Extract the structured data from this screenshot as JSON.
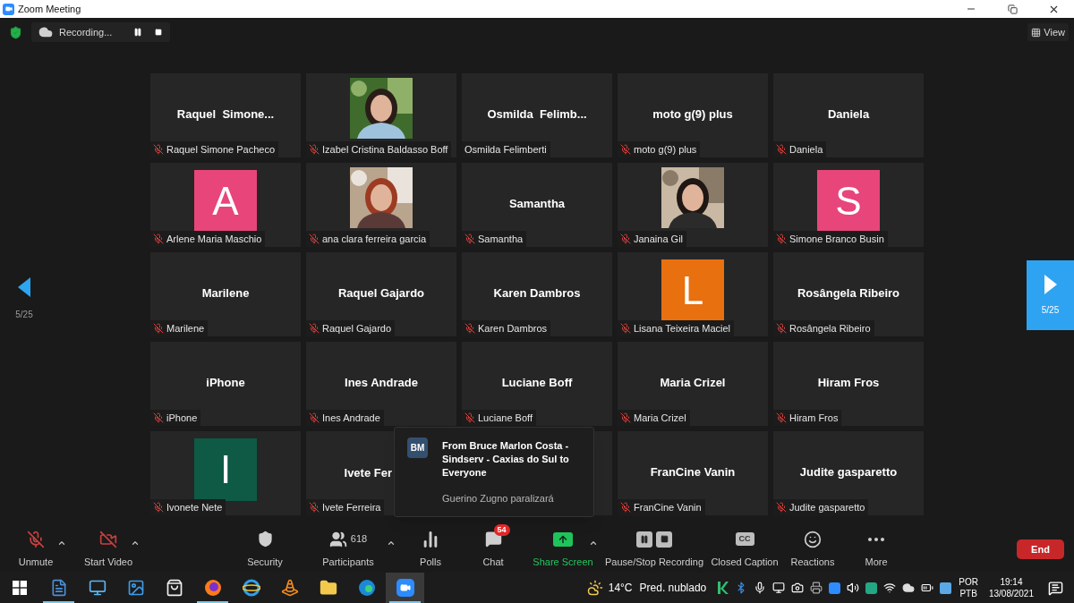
{
  "window": {
    "title": "Zoom Meeting"
  },
  "recording": {
    "label": "Recording..."
  },
  "view_button": {
    "label": "View"
  },
  "pager_left": {
    "label": "5/25"
  },
  "pager_right": {
    "label": "5/25"
  },
  "tiles": [
    {
      "kind": "name",
      "title": "Raquel  Simone...",
      "name": "Raquel Simone Pacheco",
      "muted": true
    },
    {
      "kind": "video",
      "name": "Izabel Cristina Baldasso Boff",
      "muted": true
    },
    {
      "kind": "name",
      "title": "Osmilda  Felimb...",
      "name": "Osmilda Felimberti",
      "muted": false
    },
    {
      "kind": "name",
      "title": "moto g(9) plus",
      "name": "moto g(9) plus",
      "muted": true
    },
    {
      "kind": "name",
      "title": "Daniela",
      "name": "Daniela",
      "muted": true
    },
    {
      "kind": "avatar",
      "letter": "A",
      "color": "#e8457b",
      "name": "Arlene Maria Maschio",
      "muted": true
    },
    {
      "kind": "video",
      "name": "ana clara ferreira garcia",
      "muted": true
    },
    {
      "kind": "name",
      "title": "Samantha",
      "name": "Samantha",
      "muted": true
    },
    {
      "kind": "video",
      "name": "Janaina Gil",
      "muted": true
    },
    {
      "kind": "avatar",
      "letter": "S",
      "color": "#e8457b",
      "name": "Simone Branco Busin",
      "muted": true
    },
    {
      "kind": "name",
      "title": "Marilene",
      "name": "Marilene",
      "muted": true
    },
    {
      "kind": "name",
      "title": "Raquel Gajardo",
      "name": "Raquel Gajardo",
      "muted": true
    },
    {
      "kind": "name",
      "title": "Karen Dambros",
      "name": "Karen Dambros",
      "muted": true
    },
    {
      "kind": "avatar",
      "letter": "L",
      "color": "#e8700f",
      "name": "Lisana Teixeira Maciel",
      "muted": true
    },
    {
      "kind": "name",
      "title": "Rosângela Ribeiro",
      "name": "Rosângela Ribeiro",
      "muted": true
    },
    {
      "kind": "name",
      "title": "iPhone",
      "name": "iPhone",
      "muted": true
    },
    {
      "kind": "name",
      "title": "Ines Andrade",
      "name": "Ines Andrade",
      "muted": true
    },
    {
      "kind": "name",
      "title": "Luciane Boff",
      "name": "Luciane Boff",
      "muted": true
    },
    {
      "kind": "name",
      "title": "Maria Crizel",
      "name": "Maria Crizel",
      "muted": true
    },
    {
      "kind": "name",
      "title": "Hiram Fros",
      "name": "Hiram Fros",
      "muted": true
    },
    {
      "kind": "avatar",
      "letter": "I",
      "color": "#0e5a45",
      "name": "Ivonete Nete",
      "muted": true
    },
    {
      "kind": "name_partial",
      "title": "Ivete Fer",
      "name": "Ivete Ferreira",
      "muted": true
    },
    {
      "kind": "covered"
    },
    {
      "kind": "name",
      "title": "FranCine Vanin",
      "name": "FranCine Vanin",
      "muted": true
    },
    {
      "kind": "name",
      "title": "Judite gasparetto",
      "name": "Judite gasparetto",
      "muted": true
    }
  ],
  "chat_popup": {
    "initials": "BM",
    "title": "From Bruce Marlon Costa - Sindserv - Caxias do Sul to Everyone",
    "message": "Guerino Zugno paralizará"
  },
  "toolbar": [
    {
      "kind": "mic",
      "label": "Unmute",
      "caret": true
    },
    {
      "kind": "video",
      "label": "Start Video",
      "caret": true
    },
    {
      "kind": "security",
      "label": "Security",
      "caret": false
    },
    {
      "kind": "participants",
      "label": "Participants",
      "count": "618",
      "caret": true
    },
    {
      "kind": "polls",
      "label": "Polls",
      "caret": false
    },
    {
      "kind": "chat",
      "label": "Chat",
      "badge": "54",
      "caret": false
    },
    {
      "kind": "share",
      "label": "Share Screen",
      "caret": true
    },
    {
      "kind": "recording",
      "label": "Pause/Stop Recording",
      "caret": false
    },
    {
      "kind": "cc",
      "label": "Closed Caption",
      "icon_text": "CC",
      "caret": false
    },
    {
      "kind": "reactions",
      "label": "Reactions",
      "caret": false
    },
    {
      "kind": "more",
      "label": "More",
      "caret": false
    }
  ],
  "end_button": {
    "label": "End"
  },
  "taskbar": {
    "apps": [
      {
        "kind": "document",
        "running": true,
        "selected": false
      },
      {
        "kind": "remote",
        "running": false,
        "selected": false
      },
      {
        "kind": "photos",
        "running": false,
        "selected": false
      },
      {
        "kind": "store",
        "running": false,
        "selected": false
      },
      {
        "kind": "firefox",
        "running": true,
        "selected": false
      },
      {
        "kind": "ie",
        "running": false,
        "selected": false
      },
      {
        "kind": "vlc",
        "running": false,
        "selected": false
      },
      {
        "kind": "folder",
        "running": false,
        "selected": false
      },
      {
        "kind": "edge",
        "running": false,
        "selected": false
      },
      {
        "kind": "zoom",
        "running": true,
        "selected": true
      }
    ],
    "weather": {
      "temp": "14°C",
      "text": "Pred. nublado"
    },
    "language": {
      "top": "POR",
      "bottom": "PTB"
    },
    "time": "19:14",
    "date": "13/08/2021"
  }
}
